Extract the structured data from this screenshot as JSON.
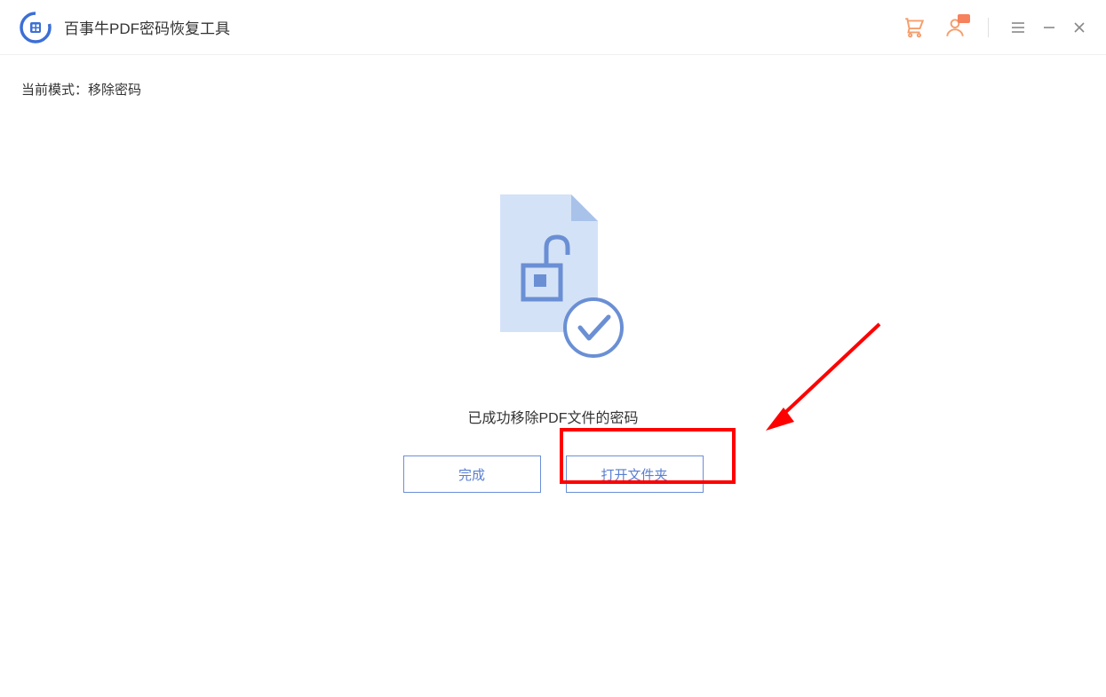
{
  "header": {
    "app_title": "百事牛PDF密码恢复工具"
  },
  "status": {
    "mode_label": "当前模式：",
    "mode_value": "移除密码"
  },
  "main": {
    "success_message": "已成功移除PDF文件的密码",
    "buttons": {
      "finish": "完成",
      "open_folder": "打开文件夹"
    }
  },
  "icons": {
    "cart": "cart-icon",
    "account": "account-icon",
    "menu": "menu-icon",
    "minimize": "minimize-icon",
    "close": "close-icon"
  },
  "colors": {
    "accent_blue": "#5a7fd0",
    "icon_orange": "#f59e6c",
    "highlight_red": "#ff0000"
  }
}
